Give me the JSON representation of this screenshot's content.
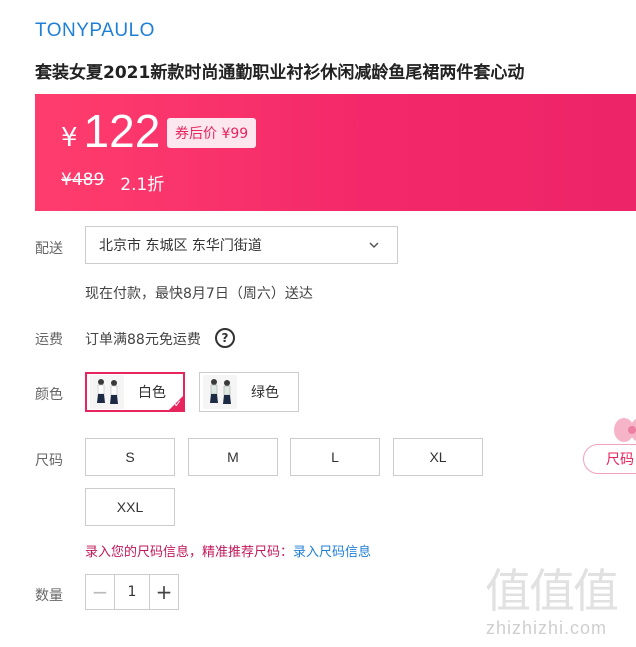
{
  "brand": "TONYPAULO",
  "title": "套装女夏2021新款时尚通勤职业衬衫休闲减龄鱼尾裙两件套心动",
  "price": {
    "currency_symbol": "¥",
    "current": "122",
    "coupon_label": "券后价 ¥99",
    "original": "¥489",
    "discount": "2.1折",
    "banner_color": "#f3286a"
  },
  "delivery": {
    "label": "配送",
    "address": "北京市 东城区 东华门街道",
    "eta": "现在付款，最快8月7日（周六）送达"
  },
  "shipping": {
    "label": "运费",
    "text": "订单满88元免运费",
    "help_icon": "?"
  },
  "color": {
    "label": "颜色",
    "options": [
      {
        "label": "白色",
        "selected": true
      },
      {
        "label": "绿色",
        "selected": false
      }
    ],
    "accent": "#e8245e"
  },
  "size": {
    "label": "尺码",
    "options": [
      "S",
      "M",
      "L",
      "XL",
      "XXL"
    ],
    "hint_text": "录入您的尺码信息，精准推荐尺码：",
    "hint_link": "录入尺码信息",
    "float_button": "尺码"
  },
  "quantity": {
    "label": "数量",
    "value": "1",
    "minus": "−",
    "plus": "+"
  },
  "watermark": {
    "main": "值值值",
    "sub": "zhizhizhi.com"
  }
}
